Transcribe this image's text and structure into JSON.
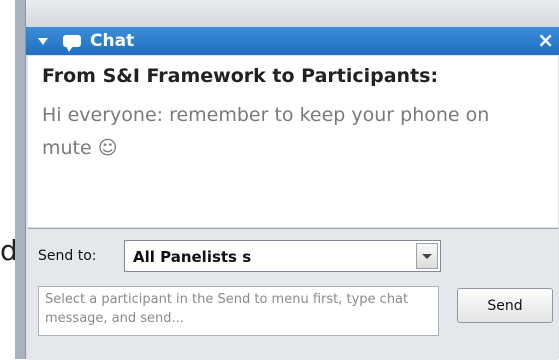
{
  "background": {
    "fragment": "d"
  },
  "chat_panel": {
    "title": "Chat",
    "icons": {
      "collapse": "triangle-down-icon",
      "chat": "chat-bubble-icon",
      "close": "close-icon"
    },
    "close_glyph": "×",
    "colors": {
      "title_bar": "#1f6fc3",
      "panel": "#dfe3e8",
      "sender_text": "#222222",
      "body_text": "#7a7a7a"
    }
  },
  "messages": [
    {
      "sender": "From S&I Framework to Participants:",
      "body": "Hi everyone: remember to keep your phone on mute ☺"
    }
  ],
  "compose": {
    "send_to_label": "Send to:",
    "send_to_selected": "All Panelists   s",
    "message_placeholder": "Select a participant in the Send to menu first, type chat message, and send...",
    "send_label": "Send"
  }
}
